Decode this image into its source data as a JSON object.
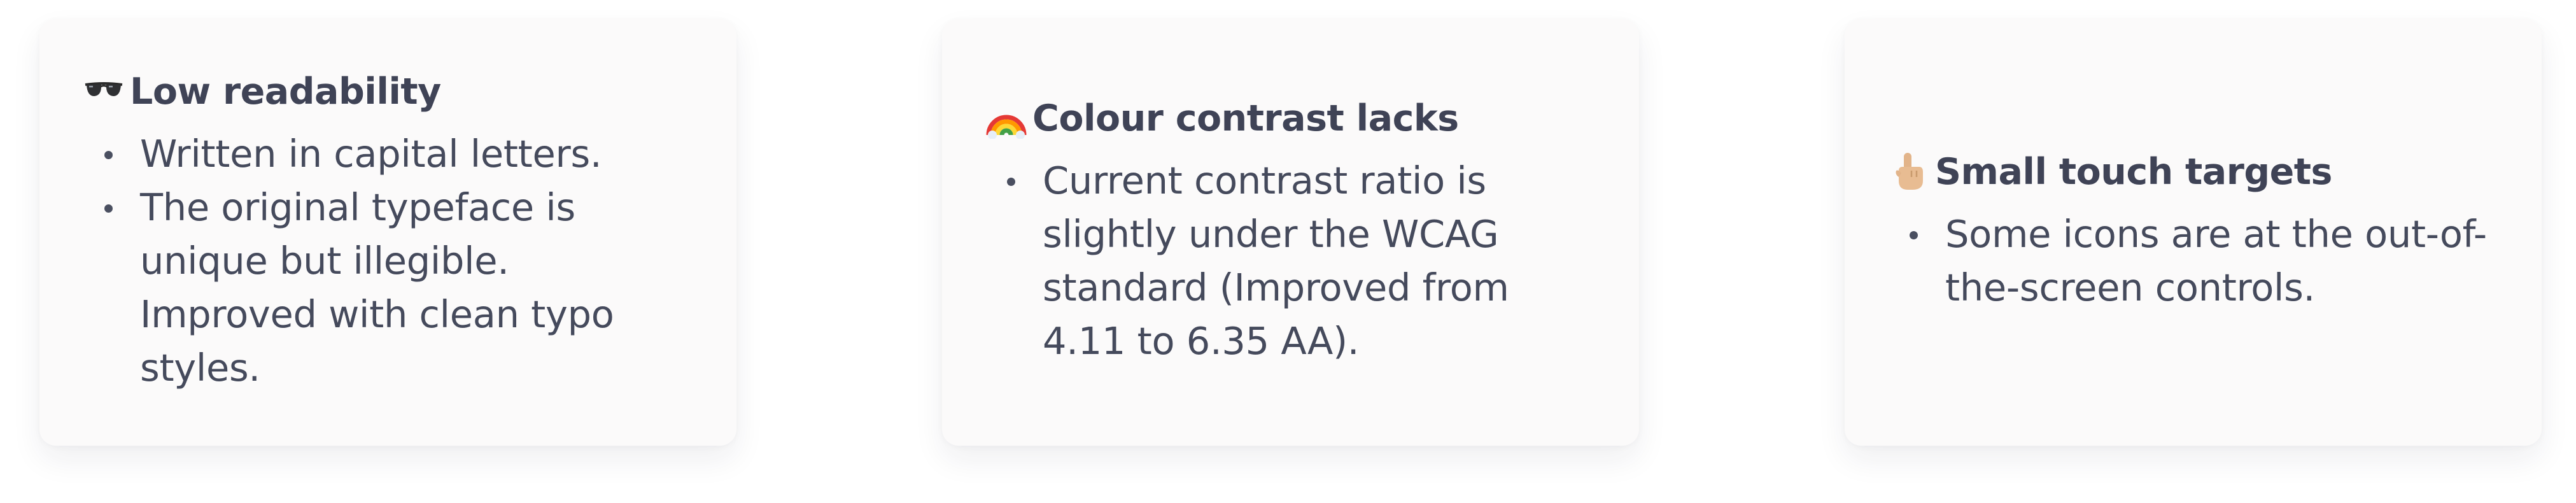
{
  "cards": [
    {
      "icon": "sunglasses-icon",
      "title": "Low readability",
      "points": [
        "Written in capital letters.",
        "The original typeface is unique but illegible. Improved with clean typo styles."
      ]
    },
    {
      "icon": "rainbow-icon",
      "title": "Colour contrast lacks",
      "points": [
        "Current contrast ratio is slightly under the WCAG standard (Improved from 4.11 to 6.35 AA)."
      ]
    },
    {
      "icon": "pointing-up-hand-icon",
      "title": "Small touch targets",
      "points": [
        "Some icons are at the out-of-the-screen controls."
      ]
    }
  ],
  "colors": {
    "card_background": "#fbfafa",
    "text": "#3a3f52",
    "page_background": "#ffffff"
  }
}
